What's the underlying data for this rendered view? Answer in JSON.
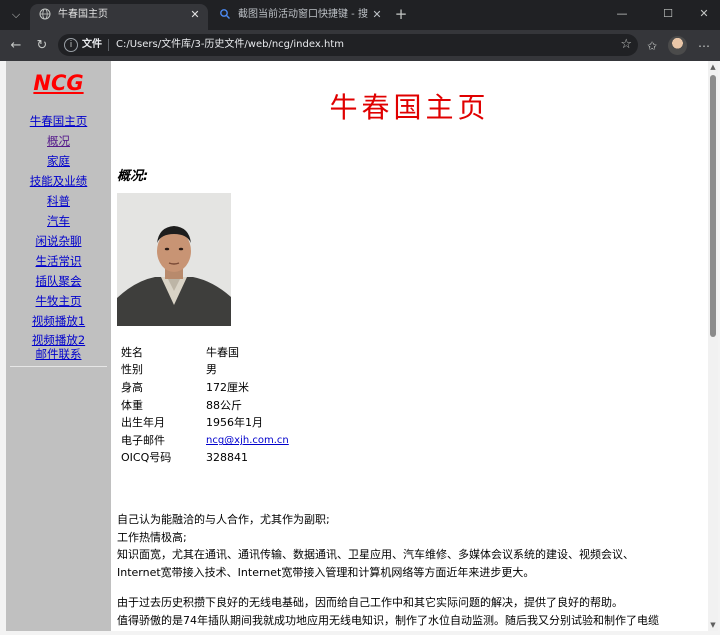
{
  "browser": {
    "tab_menu_icon": "chevron-down-icon",
    "tabs": [
      {
        "title": "牛春国主页",
        "icon": "globe-icon",
        "active": true
      },
      {
        "title": "截图当前活动窗口快捷键 - 搜索",
        "icon": "search-icon",
        "active": false
      }
    ],
    "omnibox": {
      "label": "文件",
      "url": "C:/Users/文件库/3-历史文件/web/ncg/index.htm"
    }
  },
  "sidebar": {
    "logo": "NCG",
    "items": [
      {
        "label": "牛春国主页"
      },
      {
        "label": "概况"
      },
      {
        "label": "家庭"
      },
      {
        "label": "技能及业绩"
      },
      {
        "label": "科普"
      },
      {
        "label": "汽车"
      },
      {
        "label": "闲说杂聊"
      },
      {
        "label": "生活常识"
      },
      {
        "label": "插队聚会"
      },
      {
        "label": "牛牧主页"
      },
      {
        "label": "视频播放1"
      },
      {
        "label": "视频播放2"
      },
      {
        "label": "邮件联系"
      }
    ]
  },
  "main": {
    "title": "牛春国主页",
    "section_heading": "概况:",
    "profile": [
      {
        "key": "姓名",
        "value": "牛春国"
      },
      {
        "key": "性别",
        "value": "男"
      },
      {
        "key": "身高",
        "value": "172厘米"
      },
      {
        "key": "体重",
        "value": "88公斤"
      },
      {
        "key": "出生年月",
        "value": "1956年1月"
      },
      {
        "key": "电子邮件",
        "value": "ncg@xjh.com.cn"
      },
      {
        "key": "OICQ号码",
        "value": "328841"
      }
    ],
    "paragraphs": [
      "自己认为能融洽的与人合作，尤其作为副职;",
      "工作热情极高;",
      "知识面宽，尤其在通讯、通讯传输、数据通讯、卫星应用、汽车维修、多媒体会议系统的建设、视频会议、",
      "Internet宽带接入技术、Internet宽带接入管理和计算机网络等方面近年来进步更大。",
      "由于过去历史积攒下良好的无线电基础，因而给自己工作中和其它实际问题的解决，提供了良好的帮助。",
      "值得骄傲的是74年插队期间我就成功地应用无线电知识，制作了水位自动监测。随后我又分别试验和制作了电缆"
    ]
  }
}
